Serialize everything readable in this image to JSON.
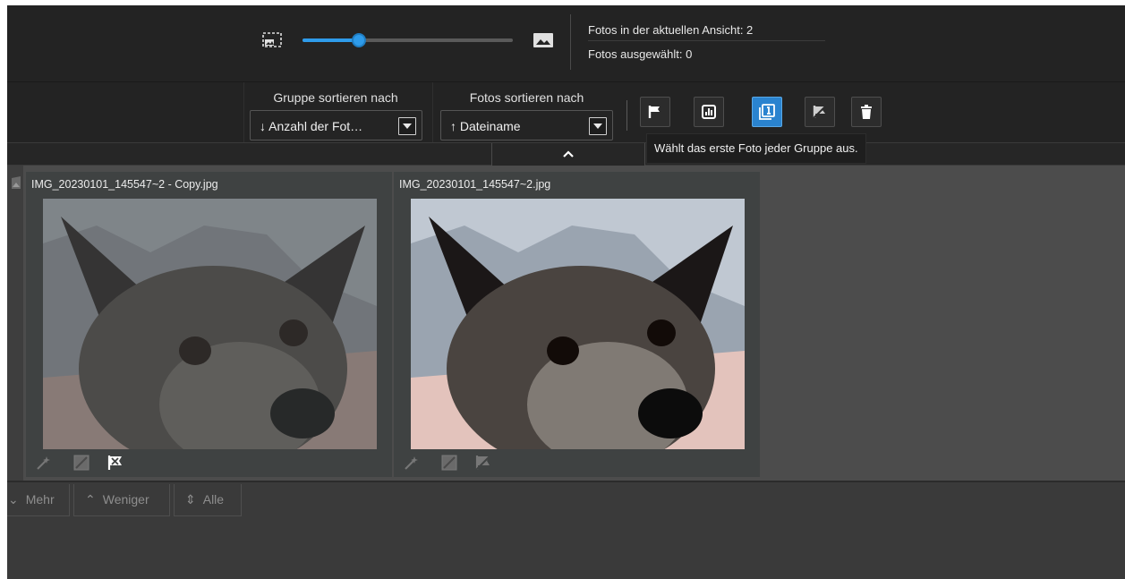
{
  "view_info": {
    "photos_in_view": "Fotos in der aktuellen Ansicht: 2",
    "photos_selected": "Fotos ausgewählt: 0"
  },
  "zoom_slider": {
    "value_fraction": 0.27
  },
  "sort": {
    "group_title": "Gruppe sortieren nach",
    "group_value": "↓ Anzahl der Fot…",
    "photos_title": "Fotos sortieren nach",
    "photos_value": "↑ Dateiname"
  },
  "toolbar_buttons": [
    {
      "icon": "flag-icon",
      "active": false
    },
    {
      "icon": "chart-icon",
      "active": false
    },
    {
      "icon": "select-first-icon",
      "active": true
    },
    {
      "icon": "unflag-icon",
      "active": false
    },
    {
      "icon": "trash-icon",
      "active": false
    }
  ],
  "tooltip": "Wählt das erste Foto jeder Gruppe aus.",
  "photos": [
    {
      "filename": "IMG_20230101_145547~2 - Copy.jpg",
      "dimmed": true
    },
    {
      "filename": "IMG_20230101_145547~2.jpg",
      "dimmed": false
    }
  ],
  "bottom": {
    "more": "Mehr",
    "less": "Weniger",
    "all": "Alle"
  },
  "colors": {
    "accent": "#2e9bea",
    "active_button": "#2a83cf",
    "background": "#232323",
    "grid": "#4c4c4c"
  }
}
